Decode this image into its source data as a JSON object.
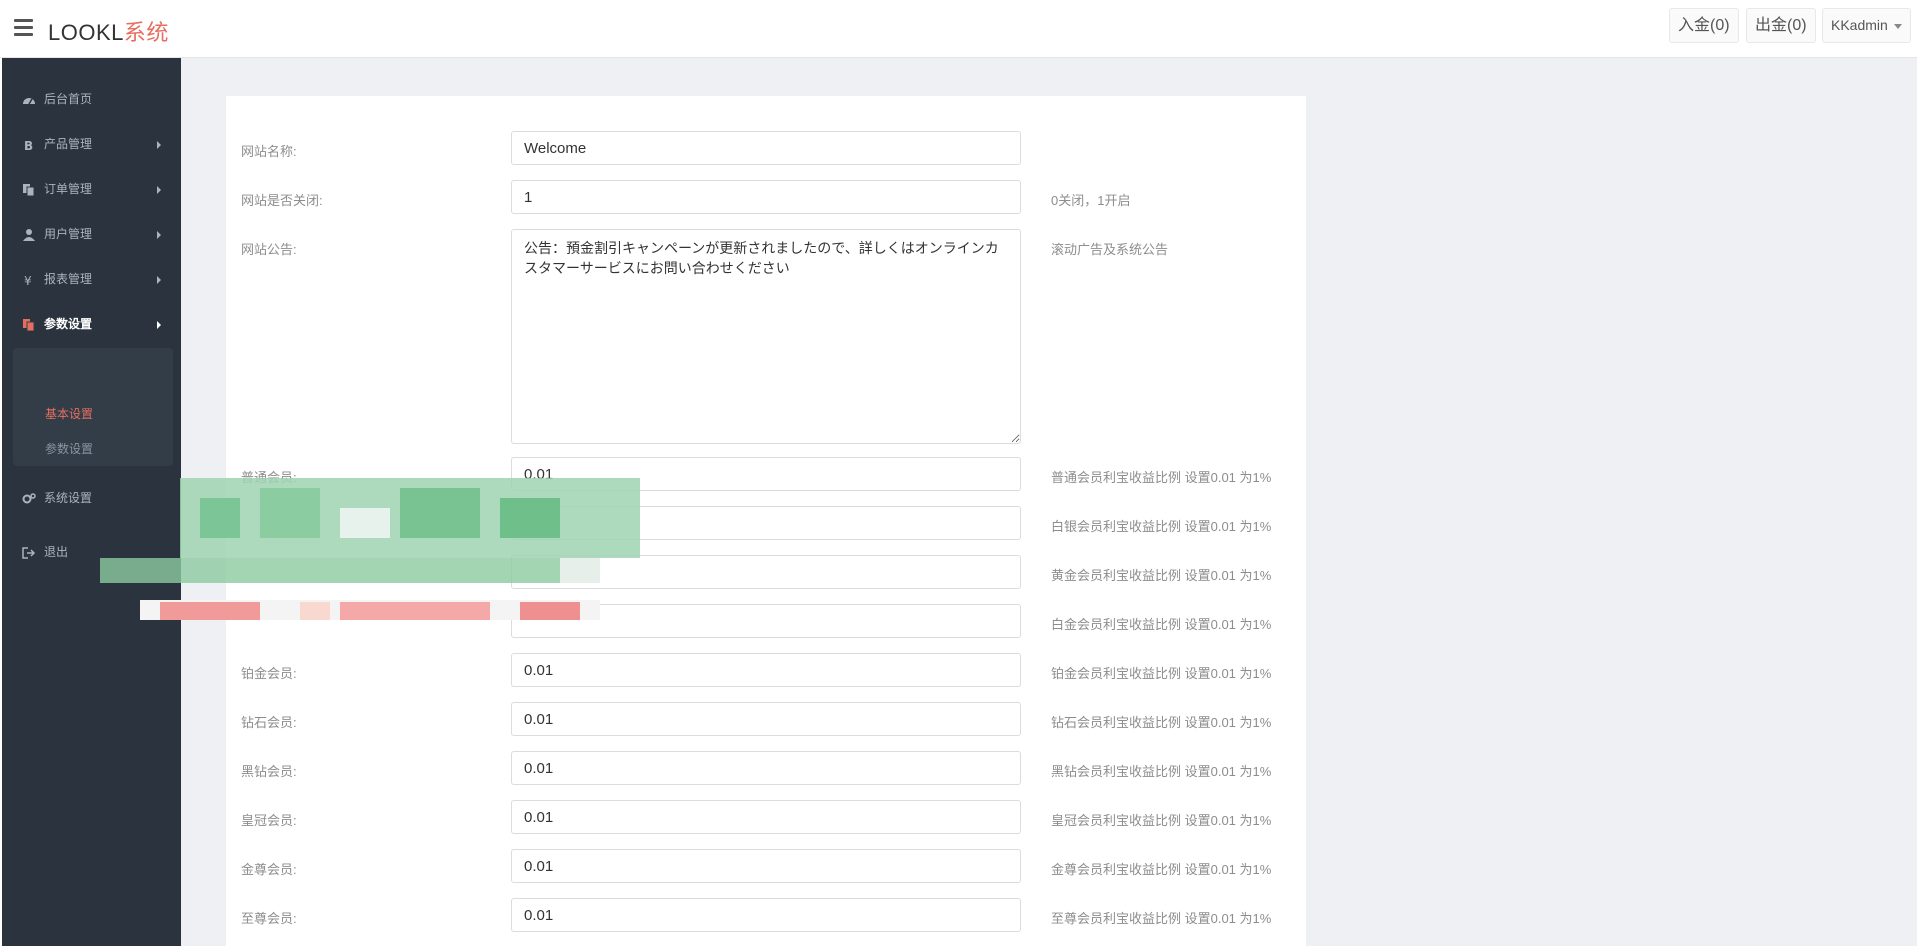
{
  "header": {
    "brand_part1": "LOOKL",
    "brand_part2": "系统",
    "deposit_button": "入金(0)",
    "withdraw_button": "出金(0)",
    "user_menu": "KKadmin"
  },
  "sidebar": {
    "items": [
      {
        "label": "后台首页",
        "icon": "dashboard-icon"
      },
      {
        "label": "产品管理",
        "icon": "bitcoin-icon"
      },
      {
        "label": "订单管理",
        "icon": "copy-icon"
      },
      {
        "label": "用户管理",
        "icon": "user-icon"
      },
      {
        "label": "报表管理",
        "icon": "yen-icon"
      },
      {
        "label": "参数设置",
        "icon": "settings-copy-icon"
      },
      {
        "label": "系统设置",
        "icon": "cogs-icon"
      },
      {
        "label": "退出",
        "icon": "sign-out-icon"
      }
    ],
    "sub_items": [
      {
        "label": "基本设置"
      },
      {
        "label": "参数设置"
      }
    ]
  },
  "form": {
    "rows": [
      {
        "label": "网站名称:",
        "value": "Welcome",
        "hint": ""
      },
      {
        "label": "网站是否关闭:",
        "value": "1",
        "hint": "0关闭，1开启"
      },
      {
        "label": "网站公告:",
        "value": "公告：預金割引キャンペーンが更新されましたので、詳しくはオンラインカスタマーサービスにお問い合わせください",
        "hint": "滚动广告及系统公告"
      },
      {
        "label": "普通会员:",
        "value": "0.01",
        "hint": "普通会员利宝收益比例 设置0.01 为1%"
      },
      {
        "label": "",
        "value": "",
        "hint": "白银会员利宝收益比例 设置0.01 为1%"
      },
      {
        "label": "",
        "value": "",
        "hint": "黄金会员利宝收益比例 设置0.01 为1%"
      },
      {
        "label": "",
        "value": "",
        "hint": "白金会员利宝收益比例 设置0.01 为1%"
      },
      {
        "label": "铂金会员:",
        "value": "0.01",
        "hint": "铂金会员利宝收益比例 设置0.01 为1%"
      },
      {
        "label": "钻石会员:",
        "value": "0.01",
        "hint": "钻石会员利宝收益比例 设置0.01 为1%"
      },
      {
        "label": "黑钻会员:",
        "value": "0.01",
        "hint": "黑钻会员利宝收益比例 设置0.01 为1%"
      },
      {
        "label": "皇冠会员:",
        "value": "0.01",
        "hint": "皇冠会员利宝收益比例 设置0.01 为1%"
      },
      {
        "label": "金尊会员:",
        "value": "0.01",
        "hint": "金尊会员利宝收益比例 设置0.01 为1%"
      },
      {
        "label": "至尊会员:",
        "value": "0.01",
        "hint": "至尊会员利宝收益比例 设置0.01 为1%"
      }
    ]
  },
  "colors": {
    "sidebar_bg": "#2b343e",
    "accent": "#e66e60",
    "page_bg": "#eef0f4"
  }
}
